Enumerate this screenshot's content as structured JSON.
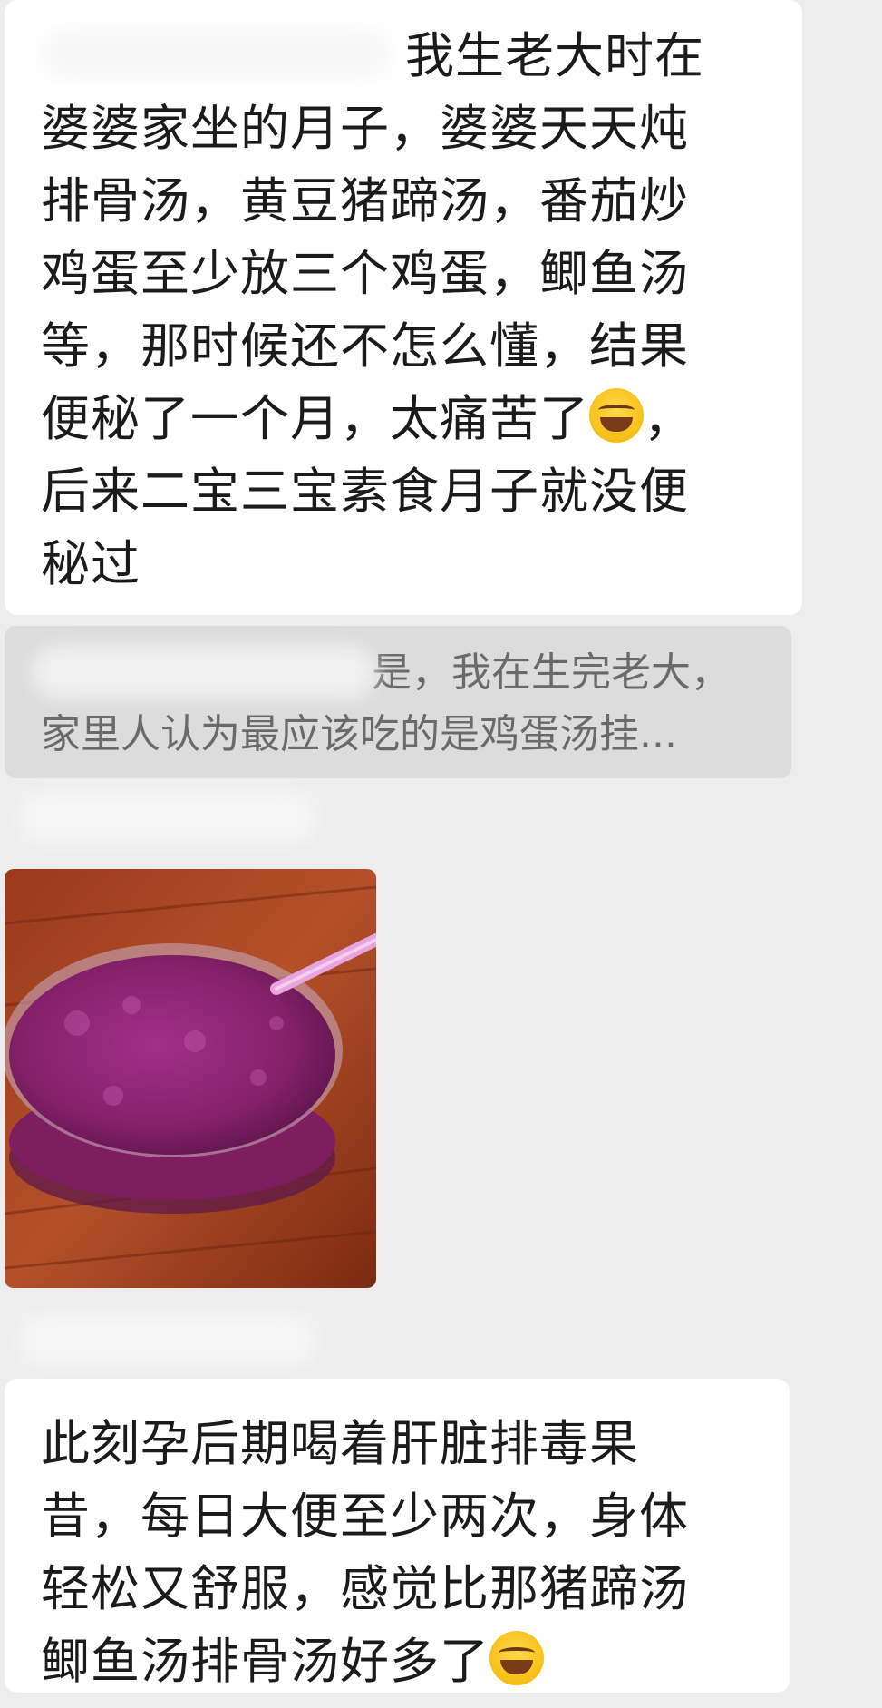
{
  "messages": [
    {
      "line1": "我生老大时在",
      "body": "婆婆家坐的月子，婆婆天天炖\n排骨汤，黄豆猪蹄汤，番茄炒\n鸡蛋至少放三个鸡蛋，鲫鱼汤\n等，那时候还不怎么懂，结果\n便秘了一个月，太痛苦了",
      "after_emoji": "，\n后来二宝三宝素食月子就没便\n秘过",
      "emoji": "face-with-tears-of-joy"
    },
    {
      "body": "此刻孕后期喝着肝脏排毒果\n昔，每日大便至少两次，身体\n轻松又舒服，感觉比那猪蹄汤\n鲫鱼汤排骨汤好多了",
      "emoji": "face-with-tears-of-joy"
    }
  ],
  "quote": {
    "line1": "是，我在生完老大，",
    "line2": "家里人认为最应该吃的是鸡蛋汤挂..."
  },
  "image": {
    "alt": "purple smoothie in glass bowl on wooden table"
  },
  "colors": {
    "background": "#ededed",
    "bubble": "#ffffff",
    "quote_bg": "#dcdcdc",
    "quote_text": "#6a6a6a",
    "smoothie": "#8a1f6a"
  }
}
